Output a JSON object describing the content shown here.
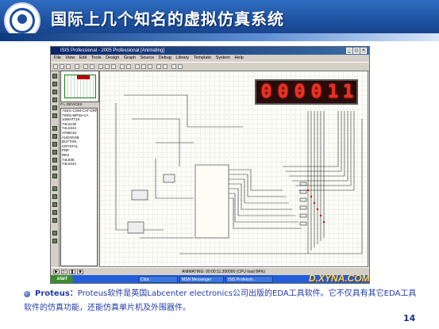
{
  "slide": {
    "title": "国际上几个知名的虚拟仿真系统",
    "bullet_lead": "Proteus：",
    "bullet_body": "Proteus软件是英国Labcenter electronics公司出版的EDA工具软件。它不仅具有其它EDA工具软件的仿真功能，还能仿真单片机及外围器件。",
    "page_number": "14",
    "accent_color": "#1d4f9e",
    "text_color": "#1f3aa8"
  },
  "proteus": {
    "window_title": "ISIS Professional - 2005 Professional [Animating]",
    "menu": [
      "File",
      "View",
      "Edit",
      "Tools",
      "Design",
      "Graph",
      "Source",
      "Debug",
      "Library",
      "Template",
      "System",
      "Help"
    ],
    "device_header": "P  L  DEVICES",
    "devices": [
      "7SEG-COM-CAT-GRN",
      "7SEG-MPX6-CA",
      "10WATT1K",
      "74LS138",
      "74LS244",
      "AT89C51",
      "AUDIOVIB",
      "BUTTON",
      "CRYSTAL",
      "PNP",
      "RES",
      "74LS06",
      "74LS244"
    ],
    "led_display": [
      "0",
      "0",
      "0",
      "0",
      "1",
      "1"
    ],
    "led_color": "#ff2a1a",
    "status_text": "ANIMATING: 00:00:11.350000 (CPU load 84%)",
    "playback_icons": [
      "play-icon",
      "step-icon",
      "pause-icon",
      "stop-icon"
    ],
    "taskbar": {
      "start_label": "start",
      "tasks": [
        "Click",
        "MSN Messenger",
        "ISIS Professio..."
      ]
    },
    "watermark": "D.XYNA.COM"
  }
}
